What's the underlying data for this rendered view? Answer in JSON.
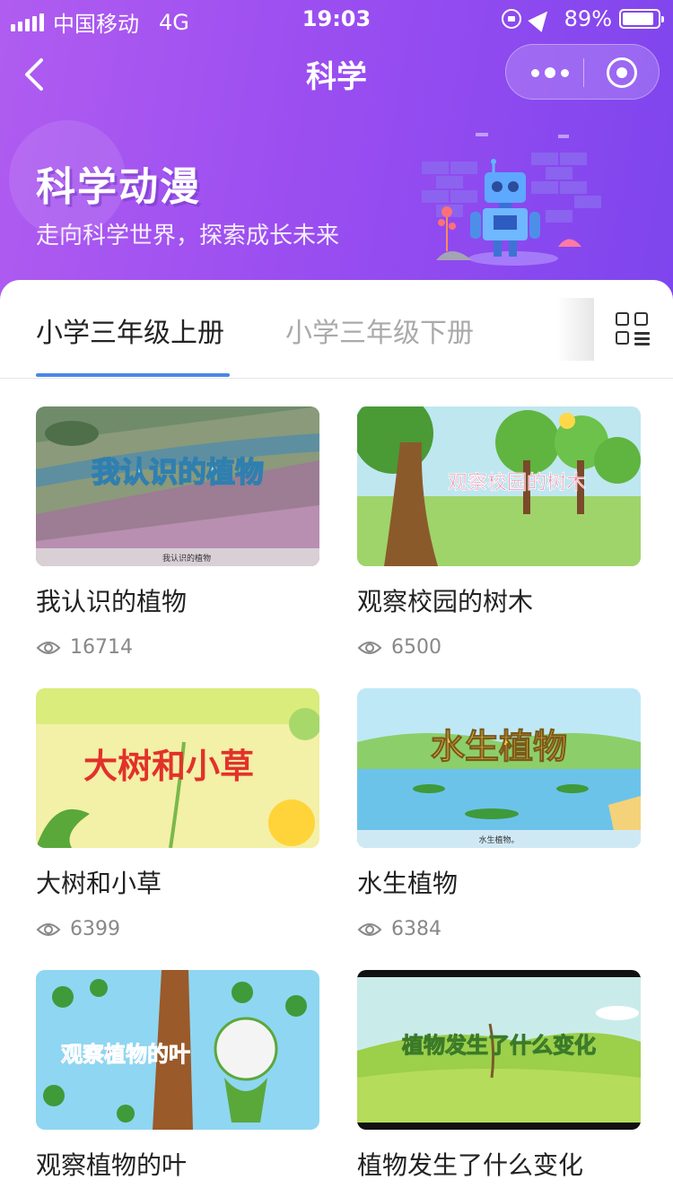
{
  "status_bar": {
    "carrier": "中国移动",
    "network": "4G",
    "time": "19:03",
    "battery": "89%",
    "battery_level": 0.89
  },
  "nav": {
    "title": "科学"
  },
  "banner": {
    "title": "科学动漫",
    "subtitle": "走向科学世界，探索成长未来"
  },
  "tabs": [
    {
      "label": "小学三年级上册",
      "active": true
    },
    {
      "label": "小学三年级下册",
      "active": false
    }
  ],
  "videos": [
    {
      "title": "我认识的植物",
      "views": "16714",
      "thumb_caption": "我认识的植物",
      "thumb_subcaption": "我认识的植物"
    },
    {
      "title": "观察校园的树木",
      "views": "6500",
      "thumb_caption": "观察校园的树木"
    },
    {
      "title": "大树和小草",
      "views": "6399",
      "thumb_caption": "大树和小草"
    },
    {
      "title": "水生植物",
      "views": "6384",
      "thumb_caption": "水生植物",
      "thumb_subcaption": "水生植物。"
    },
    {
      "title": "观察植物的叶",
      "views": "",
      "thumb_caption": "观察植物的叶"
    },
    {
      "title": "植物发生了什么变化",
      "views": "",
      "thumb_caption": "植物发生了什么变化"
    }
  ],
  "colors": {
    "header_start": "#b05cf0",
    "header_end": "#7e45ee",
    "tab_accent": "#4a86e8"
  }
}
